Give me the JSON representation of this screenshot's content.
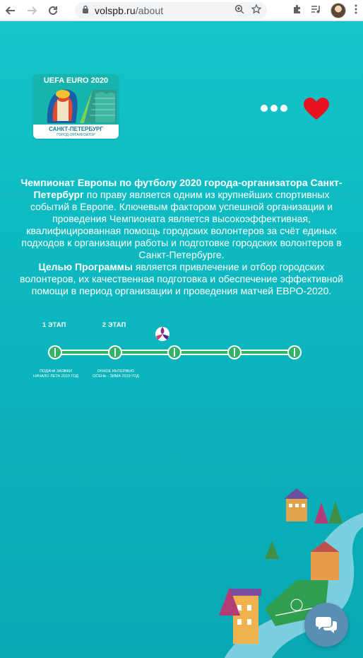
{
  "browser": {
    "url_domain": "volspb.ru",
    "url_path": "/about"
  },
  "logo": {
    "top_text": "UEFA EURO 2020",
    "city": "САНКТ-ПЕТЕРБУРГ",
    "subtitle": "ГОРОД-ОРГАНИЗАТОР"
  },
  "intro": {
    "p1_bold": "Чемпионат Европы по футболу 2020 города-организатора Санкт-Петербург",
    "p1_text": " по праву является одним из крупнейших спортивных событий в Европе. Ключевым фактором успешной организации и проведения Чемпионата является высокоэффективная, квалифицированная помощь городских волонтеров за счёт единых подходов к организации работы и подготовке городских волонтеров в Санкт-Петербурге.",
    "p2_bold": "Целью Программы",
    "p2_text": " является привлечение и отбор городских волонтеров, их качественная подготовка и обеспечение эффективной помощи в период организации и проведения матчей ЕВРО-2020."
  },
  "timeline": {
    "stages": [
      {
        "label": "1 ЭТАП",
        "note_line1": "ПОДАЧА ЗАЯВКИ",
        "note_line2": "НАЧАЛО ЛЕТА 2019 ГОД"
      },
      {
        "label": "2 ЭТАП",
        "note_line1": "ОЧНОЕ ИНТЕРВЬЮ",
        "note_line2": "ОСЕНЬ - ЗИМА 2019 ГОД"
      }
    ],
    "current_stage": 3,
    "total_points": 5
  },
  "colors": {
    "background": "#0fb9c0",
    "timeline": "#2fb564",
    "heart": "#e8121f",
    "chat": "#5a8fb3"
  }
}
